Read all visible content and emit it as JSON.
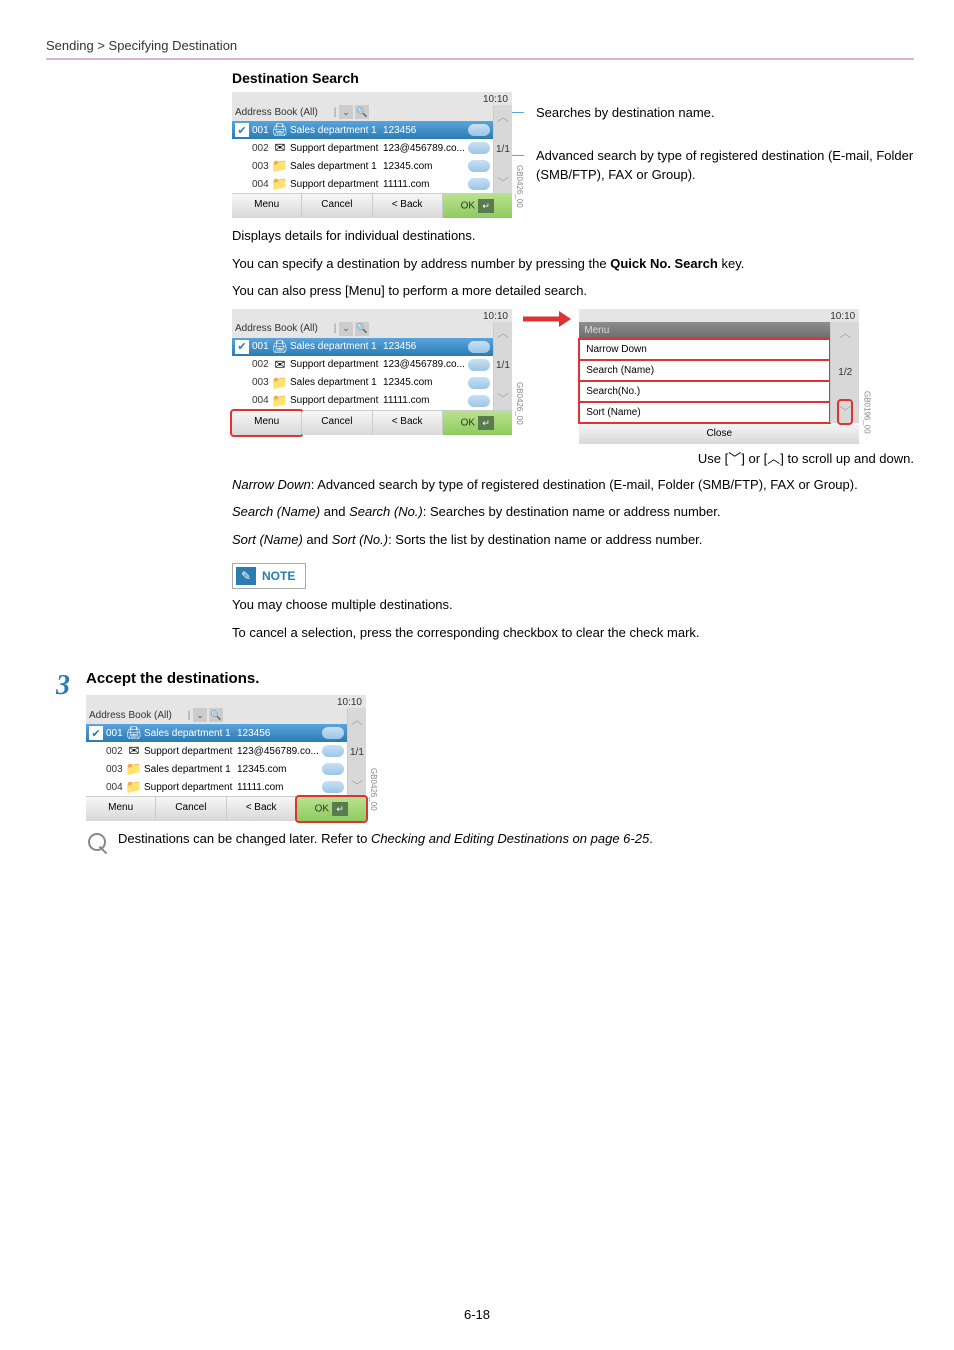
{
  "breadcrumb": "Sending > Specifying Destination",
  "section_title": "Destination Search",
  "clock": "10:10",
  "panel_title": "Address Book (All)",
  "rows": [
    {
      "num": "001",
      "name": "Sales department 1",
      "addr": "123456",
      "selected": true,
      "type": "smb"
    },
    {
      "num": "002",
      "name": "Support department",
      "addr": "123@456789.co...",
      "selected": false,
      "type": "mail"
    },
    {
      "num": "003",
      "name": "Sales department 1",
      "addr": "12345.com",
      "selected": false,
      "type": "ftp"
    },
    {
      "num": "004",
      "name": "Support department",
      "addr": "11111.com",
      "selected": false,
      "type": "ftp"
    }
  ],
  "page_indicator": "1/1",
  "btns": {
    "menu": "Menu",
    "cancel": "Cancel",
    "back": "< Back",
    "ok": "OK"
  },
  "side_note_1": "Searches by destination name.",
  "side_note_2": "Advanced search by type of registered destination (E-mail, Folder (SMB/FTP), FAX or Group).",
  "under_panel_1": "Displays details for individual destinations.",
  "body_1a": "You can specify a destination by address number by pressing the ",
  "body_1b": "Quick No. Search",
  "body_1c": " key.",
  "body_2": "You can also press [Menu] to perform a more detailed search.",
  "menu_title": "Menu",
  "menu_items": [
    "Narrow Down",
    "Search (Name)",
    "Search(No.)",
    "Sort (Name)"
  ],
  "menu_page": "1/2",
  "menu_close": "Close",
  "scroll_caption_a": "Use [",
  "scroll_caption_b": "] or [",
  "scroll_caption_c": "] to scroll up and down.",
  "narrow_down_i": "Narrow Down",
  "narrow_down_t": ": Advanced search by type of registered destination (E-mail, Folder (SMB/FTP), FAX or Group).",
  "search_i1": "Search (Name)",
  "search_and": " and ",
  "search_i2": "Search (No.)",
  "search_t": ": Searches by destination name or address number.",
  "sort_i1": "Sort (Name)",
  "sort_i2": "Sort (No.)",
  "sort_t": ": Sorts the list by destination name or address number.",
  "note_label": "NOTE",
  "note_text_1": "You may choose multiple destinations.",
  "note_text_2": "To cancel a selection, press the corresponding checkbox to clear the check mark.",
  "step_num": "3",
  "step_title": "Accept the destinations.",
  "footnote_a": "Destinations can be changed later. Refer to ",
  "footnote_i": "Checking and Editing Destinations on page 6-25",
  "footnote_b": ".",
  "page_num": "6-18",
  "codes": {
    "panel1": "GB0426_00",
    "panel2": "GB0426_00",
    "panelMenu": "GB0196_00",
    "panel3": "GB0426_00"
  }
}
